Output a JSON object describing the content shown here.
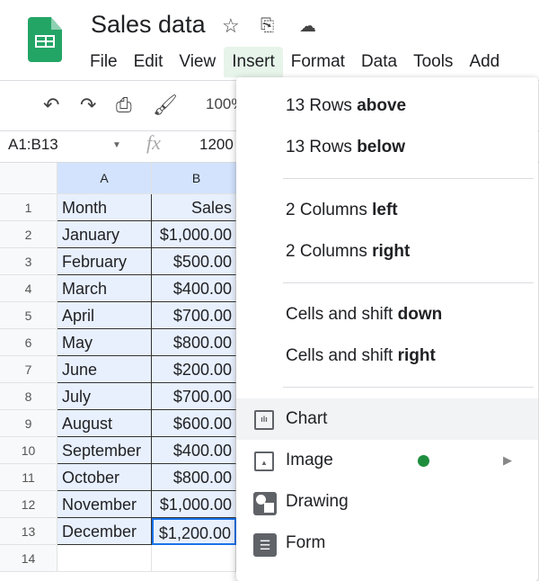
{
  "doc": {
    "title": "Sales data"
  },
  "menubar": [
    "File",
    "Edit",
    "View",
    "Insert",
    "Format",
    "Data",
    "Tools",
    "Add"
  ],
  "toolbar": {
    "zoom": "100%"
  },
  "formula": {
    "namebox": "A1:B13",
    "value": "1200"
  },
  "grid": {
    "columns": [
      "A",
      "B"
    ],
    "rows": [
      [
        "Month",
        "Sales"
      ],
      [
        "January",
        "$1,000.00"
      ],
      [
        "February",
        "$500.00"
      ],
      [
        "March",
        "$400.00"
      ],
      [
        "April",
        "$700.00"
      ],
      [
        "May",
        "$800.00"
      ],
      [
        "June",
        "$200.00"
      ],
      [
        "July",
        "$700.00"
      ],
      [
        "August",
        "$600.00"
      ],
      [
        "September",
        "$400.00"
      ],
      [
        "October",
        "$800.00"
      ],
      [
        "November",
        "$1,000.00"
      ],
      [
        "December",
        "$1,200.00"
      ],
      [
        "",
        ""
      ]
    ],
    "row_numbers": [
      "1",
      "2",
      "3",
      "4",
      "5",
      "6",
      "7",
      "8",
      "9",
      "10",
      "11",
      "12",
      "13",
      "14"
    ]
  },
  "insert_menu": {
    "rows_above": {
      "pre": "13 Rows ",
      "bold": "above"
    },
    "rows_below": {
      "pre": "13 Rows ",
      "bold": "below"
    },
    "cols_left": {
      "pre": "2 Columns ",
      "bold": "left"
    },
    "cols_right": {
      "pre": "2 Columns ",
      "bold": "right"
    },
    "shift_down": {
      "pre": "Cells and shift ",
      "bold": "down"
    },
    "shift_right": {
      "pre": "Cells and shift ",
      "bold": "right"
    },
    "chart": "Chart",
    "image": "Image",
    "drawing": "Drawing",
    "form": "Form"
  },
  "colors": {
    "brand": "#23a566",
    "selection": "#e8f0fe",
    "new_dot": "#1e8e3e"
  }
}
